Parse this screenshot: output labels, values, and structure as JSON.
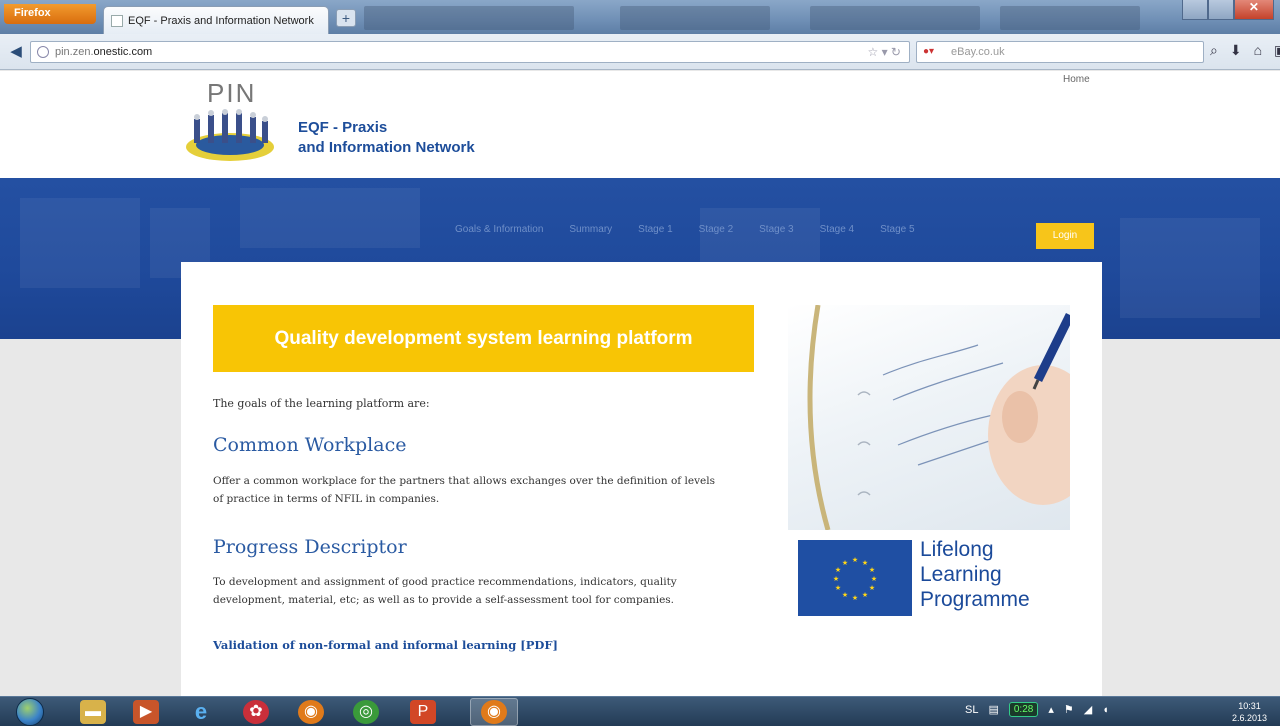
{
  "browser": {
    "menu_label": "Firefox",
    "tab_title": "EQF - Praxis and Information Network",
    "newtab_symbol": "+",
    "url_prefix": "pin.zen.",
    "url_domain": "onestic.com",
    "search_engine": "eBay",
    "search_placeholder": "eBay.co.uk"
  },
  "header": {
    "logo_text": "PIN",
    "title_line1": "EQF - Praxis",
    "title_line2": "and Information Network",
    "home_link": "Home"
  },
  "nav": {
    "items": [
      "Goals & Information",
      "Summary",
      "Stage 1",
      "Stage 2",
      "Stage 3",
      "Stage 4",
      "Stage 5"
    ],
    "login_label": "Login"
  },
  "content": {
    "banner": "Quality development system learning platform",
    "intro": "The goals of the learning platform are:",
    "section1_title": "Common Workplace",
    "section1_line1": "Offer a common workplace for the partners that allows exchanges over the definition of levels",
    "section1_line2": "of practice in terms of NFIL in companies.",
    "section2_title": "Progress Descriptor",
    "section2_line1": "To development and assignment of good practice recommendations, indicators, quality",
    "section2_line2": "development, material, etc; as well as to provide a self-assessment tool for companies.",
    "pdf_link": "Validation of non-formal and informal learning [PDF]"
  },
  "sidebar": {
    "llp_line1": "Lifelong",
    "llp_line2": "Learning",
    "llp_line3": "Programme"
  },
  "taskbar": {
    "battery": "0:28",
    "lang": "SL",
    "clock_time": "10:31",
    "clock_date": "2.6.2013"
  },
  "colors": {
    "brand_blue": "#1f4a9c",
    "banner_yellow": "#f8c505",
    "heading_blue": "#2a5aa2"
  }
}
